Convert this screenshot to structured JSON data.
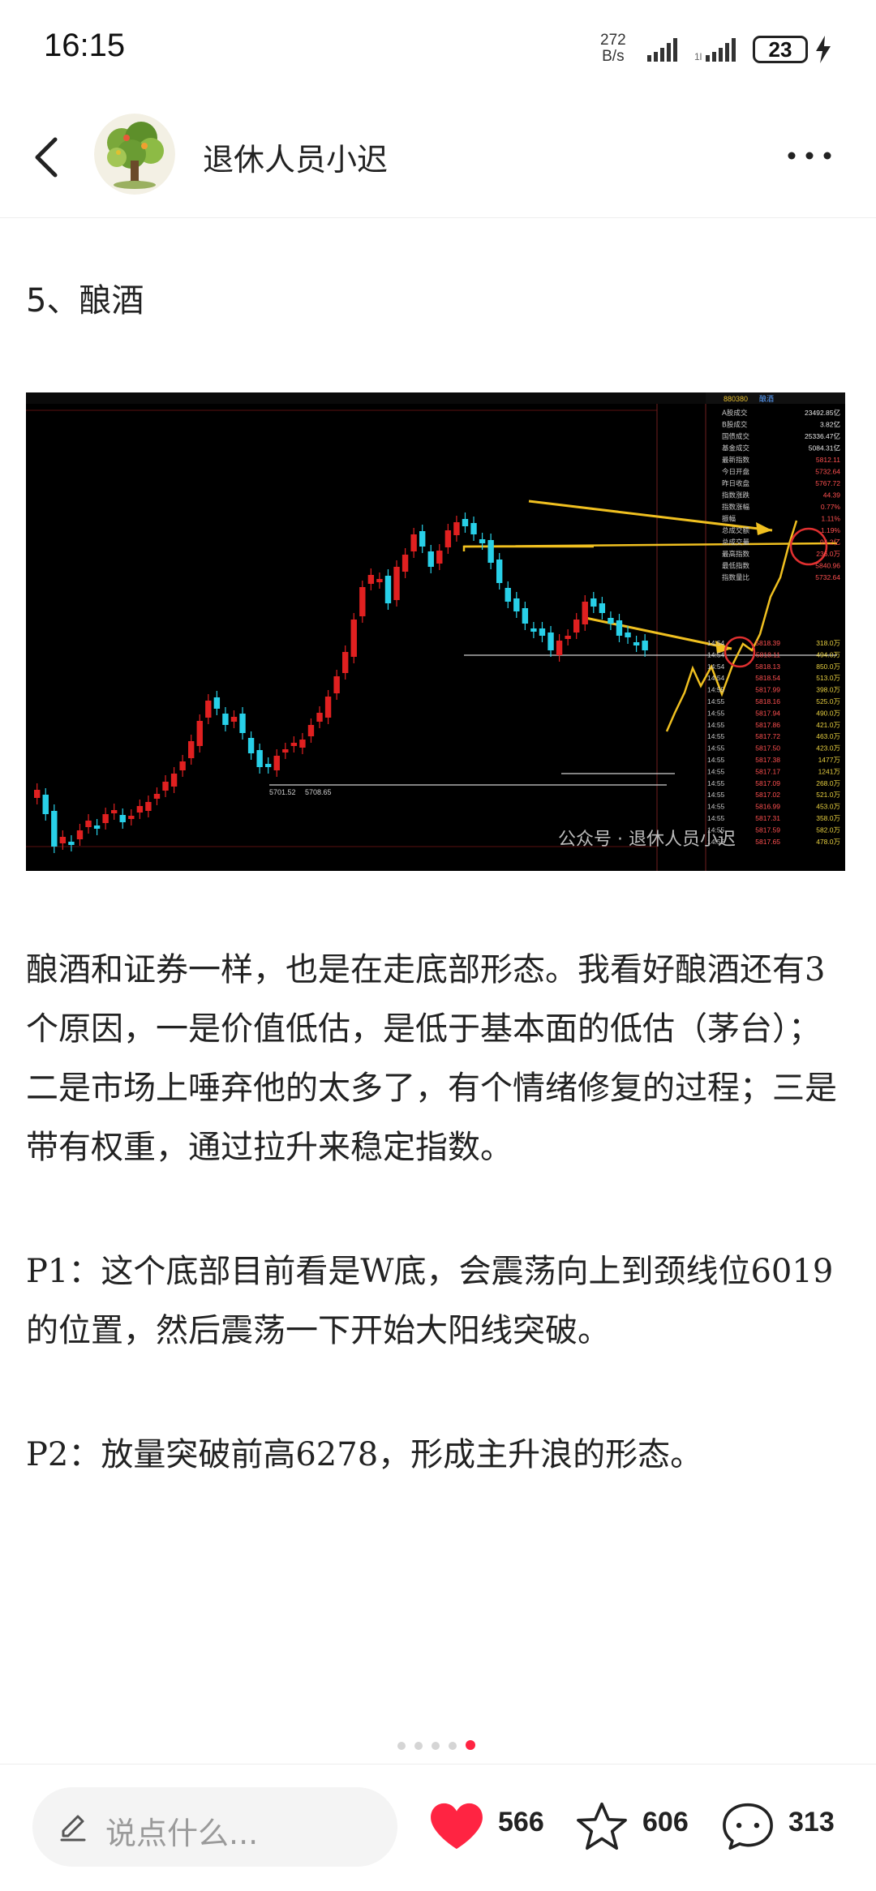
{
  "status_bar": {
    "time": "16:15",
    "net_speed_value": "272",
    "net_speed_unit": "B/s",
    "battery": "23"
  },
  "header": {
    "author_name": "退休人员小迟"
  },
  "article": {
    "section_title": "5、酿酒",
    "paragraph_1": "酿酒和证券一样，也是在走底部形态。我看好酿酒还有3个原因，一是价值低估，是低于基本面的低估（茅台）；二是市场上唾弃他的太多了，有个情绪修复的过程；三是带有权重，通过拉升来稳定指数。",
    "paragraph_2": "P1：这个底部目前看是W底，会震荡向上到颈线位6019的位置，然后震荡一下开始大阳线突破。",
    "paragraph_3": "P2：放量突破前高6278，形成主升浪的形态。"
  },
  "chart_image": {
    "watermark": "公众号 · 退休人员小迟",
    "low_label_1": "5701.52",
    "low_label_2": "5708.65",
    "code": "880380",
    "name": "酿酒",
    "side_labels": [
      "A股成交",
      "B股成交",
      "国债成交",
      "基金成交",
      "最新指数",
      "今日开盘",
      "昨日收盘",
      "指数涨跌",
      "指数涨幅",
      "振幅",
      "总成交额",
      "总成交量",
      "最高指数",
      "最低指数",
      "指数量比"
    ],
    "side_values": [
      "23492.85亿",
      "3.82亿",
      "25336.47亿",
      "5084.31亿",
      "5812.11",
      "5732.64",
      "5767.72",
      "44.39",
      "0.77%",
      "1.11%",
      "1.19%",
      "94.2亿",
      "236.0万",
      "5840.96",
      "5732.64",
      "1.28"
    ],
    "tick_times": [
      "14:54",
      "14:54",
      "14:54",
      "14:54",
      "14:55",
      "14:55",
      "14:55",
      "14:55",
      "14:55",
      "14:55",
      "14:55",
      "14:55",
      "14:55",
      "14:55",
      "14:55",
      "14:55",
      "14:55",
      "14:55"
    ],
    "tick_prices": [
      "5818.39",
      "5818.11",
      "5818.13",
      "5818.54",
      "5817.99",
      "5818.16",
      "5817.94",
      "5817.86",
      "5817.72",
      "5817.50",
      "5817.38",
      "5817.17",
      "5817.09",
      "5817.02",
      "5816.99",
      "5817.31",
      "5817.59",
      "5817.65"
    ],
    "tick_vols": [
      "318.0万",
      "494.0万",
      "850.0万",
      "513.0万",
      "398.0万",
      "525.0万",
      "490.0万",
      "421.0万",
      "463.0万",
      "423.0万",
      "1477万",
      "1241万",
      "268.0万",
      "521.0万",
      "453.0万",
      "358.0万",
      "582.0万",
      "478.0万"
    ]
  },
  "page_indicator": {
    "total": 5,
    "active_index": 4
  },
  "bottom_bar": {
    "comment_placeholder": "说点什么...",
    "likes": "566",
    "favorites": "606",
    "comments": "313"
  },
  "colors": {
    "like_red": "#ff2442",
    "candle_red": "#e02020",
    "candle_cyan": "#28d0e8",
    "annotation_yellow": "#f0c020"
  }
}
